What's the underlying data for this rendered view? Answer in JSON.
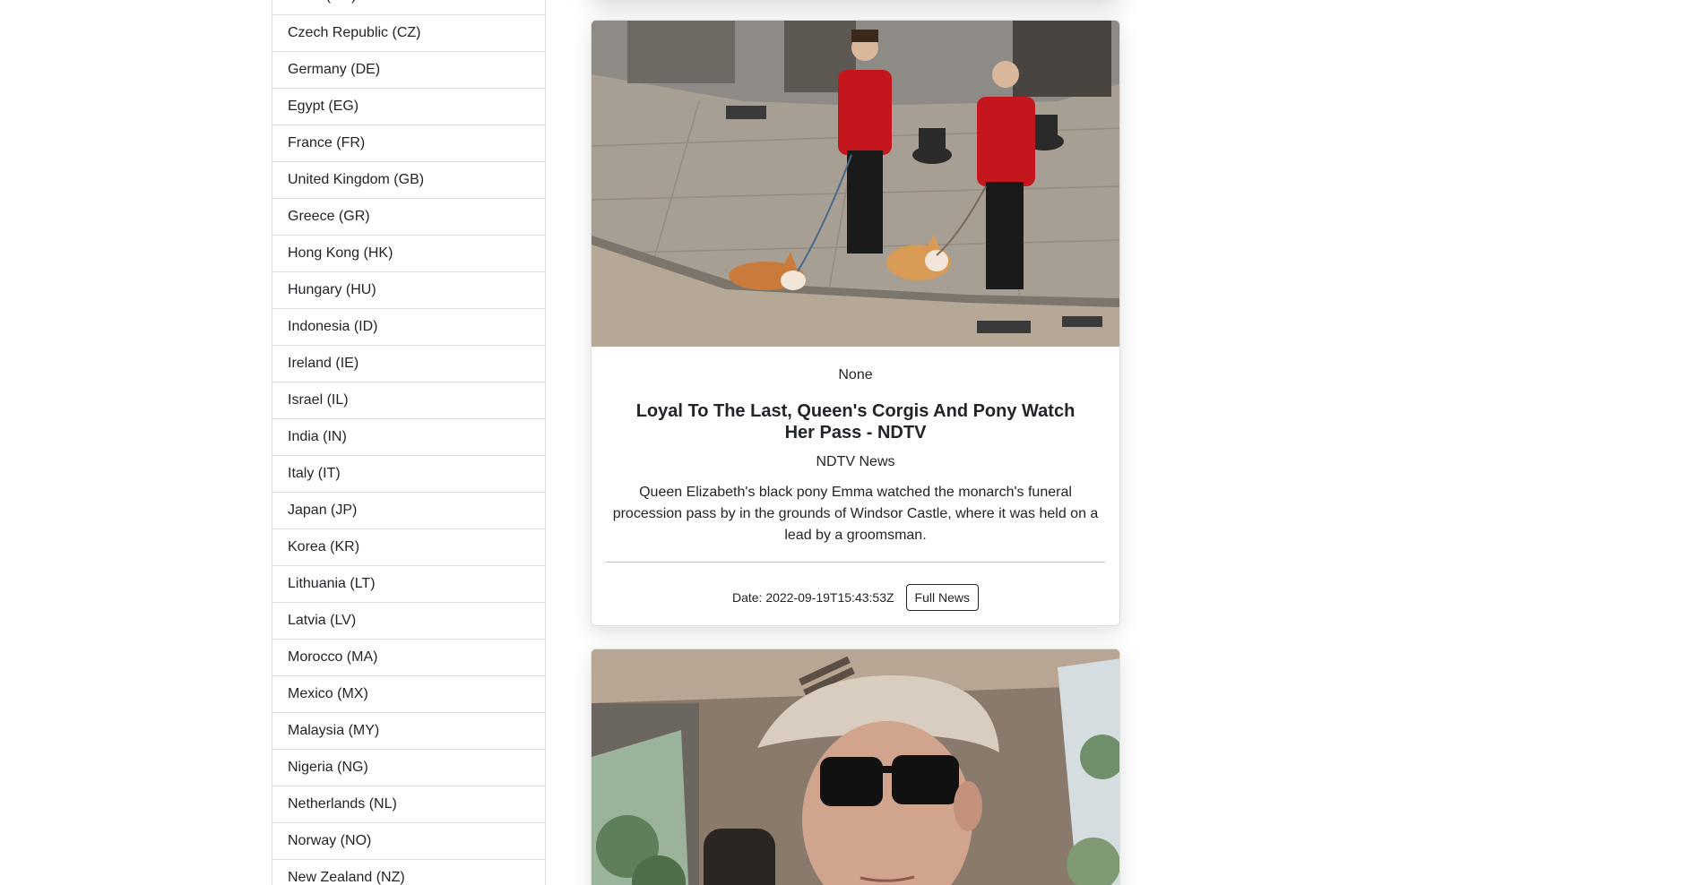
{
  "countries": [
    "Cuba (CU)",
    "Czech Republic (CZ)",
    "Germany (DE)",
    "Egypt (EG)",
    "France (FR)",
    "United Kingdom (GB)",
    "Greece (GR)",
    "Hong Kong (HK)",
    "Hungary (HU)",
    "Indonesia (ID)",
    "Ireland (IE)",
    "Israel (IL)",
    "India (IN)",
    "Italy (IT)",
    "Japan (JP)",
    "Korea (KR)",
    "Lithuania (LT)",
    "Latvia (LV)",
    "Morocco (MA)",
    "Mexico (MX)",
    "Malaysia (MY)",
    "Nigeria (NG)",
    "Netherlands (NL)",
    "Norway (NO)",
    "New Zealand (NZ)"
  ],
  "article": {
    "author": "None",
    "title": "Loyal To The Last, Queen's Corgis And Pony Watch Her Pass - NDTV",
    "source": "NDTV News",
    "description": "Queen Elizabeth's black pony Emma watched the monarch's funeral procession pass by in the grounds of Windsor Castle, where it was held on a lead by a groomsman.",
    "date": "Date: 2022-09-19T15:43:53Z",
    "button_label": "Full News"
  }
}
